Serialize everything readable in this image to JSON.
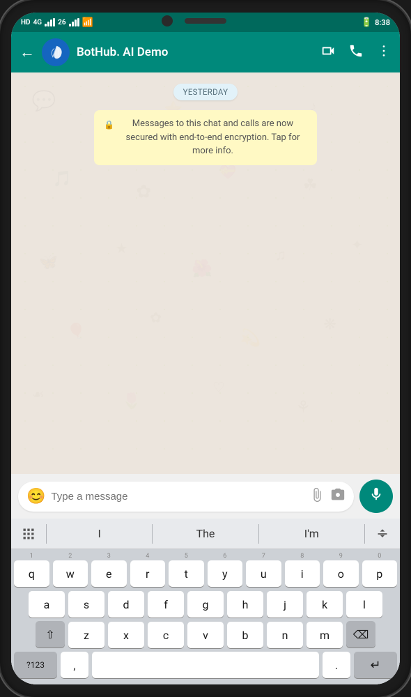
{
  "status_bar": {
    "left": "HD  4G  26",
    "time": "8:38",
    "carrier1": "HD",
    "carrier2": "4G",
    "signal": "26"
  },
  "header": {
    "back_label": "←",
    "contact_name": "BotHub. AI Demo",
    "video_icon": "video-camera",
    "phone_icon": "phone",
    "more_icon": "more-vertical"
  },
  "chat": {
    "date_badge": "YESTERDAY",
    "encryption_notice": "Messages to this chat and calls are now secured with end-to-end encryption. Tap for more info."
  },
  "input": {
    "placeholder": "Type a message",
    "emoji_label": "😊",
    "attachment_label": "📎",
    "camera_label": "📷",
    "mic_label": "🎤"
  },
  "keyboard": {
    "suggestions": [
      "I",
      "The",
      "I'm"
    ],
    "collapse_icon": "⌨",
    "grid_icon": "⊞",
    "rows": [
      [
        "1\nq",
        "2\nw",
        "3\ne",
        "4\nr",
        "5\nt",
        "6\ny",
        "7\nu",
        "8\ni",
        "9\no",
        "0\np"
      ],
      [
        "a",
        "s",
        "d",
        "f",
        "g",
        "h",
        "j",
        "k",
        "l"
      ],
      [
        "⇧",
        "z",
        "x",
        "c",
        "v",
        "b",
        "n",
        "m",
        "⌫"
      ]
    ],
    "bottom_keys": [
      "?123",
      ",",
      " ",
      ".",
      "↵"
    ]
  }
}
